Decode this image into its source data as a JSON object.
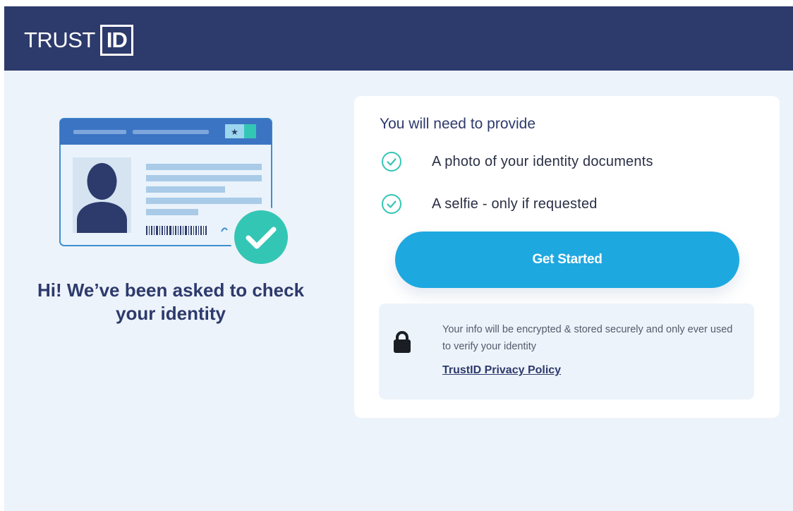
{
  "header": {
    "logo_trust": "TRUST",
    "logo_id": "ID"
  },
  "hero": {
    "heading": "Hi! We’ve been asked to check your identity",
    "illustration_icon": "id-card-check-icon"
  },
  "requirements": {
    "title": "You will need to provide",
    "items": [
      {
        "label": "A photo of your identity documents",
        "icon": "check-circle-icon"
      },
      {
        "label": "A selfie - only if requested",
        "icon": "check-circle-icon"
      }
    ]
  },
  "cta": {
    "label": "Get Started"
  },
  "privacy": {
    "icon": "lock-icon",
    "text": "Your info will be encrypted & stored securely and only ever used to verify your identity",
    "link_label": "TrustID Privacy Policy"
  },
  "colors": {
    "header_bg": "#2d3a6c",
    "page_bg": "#edf3fa",
    "accent": "#1ea8e0",
    "check": "#34c6b5"
  }
}
